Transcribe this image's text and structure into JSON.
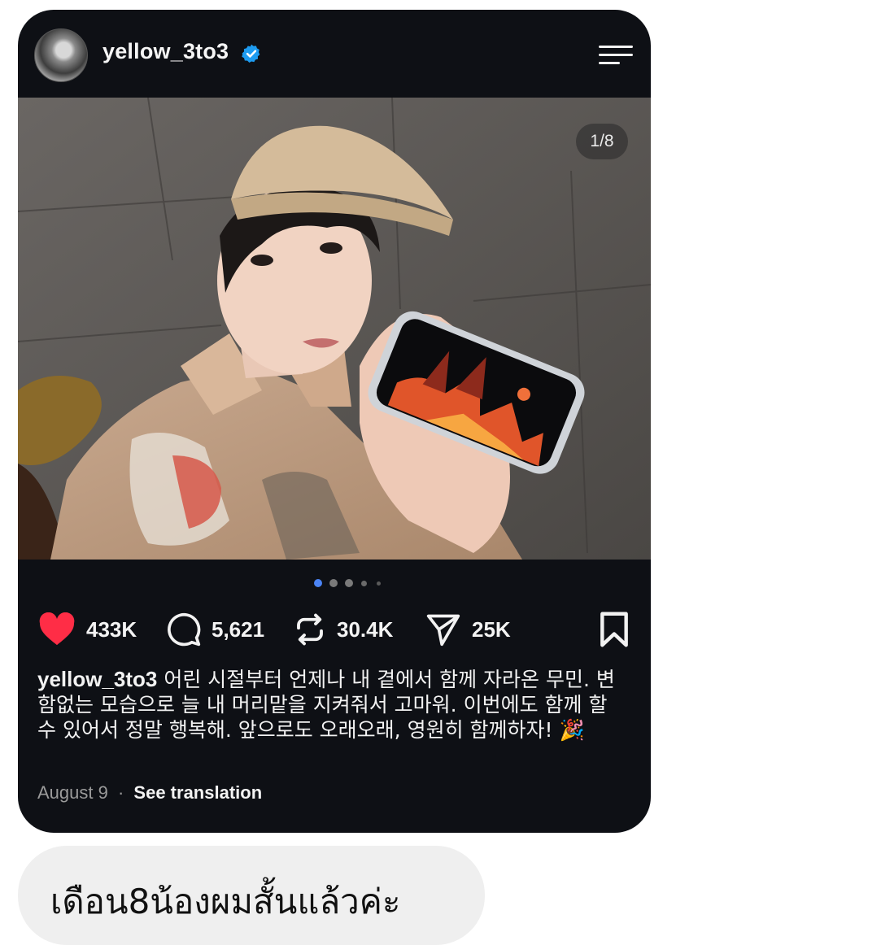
{
  "post": {
    "username": "yellow_3to3",
    "slide_counter": "1/8",
    "likes": "433K",
    "comments": "5,621",
    "reposts": "30.4K",
    "shares": "25K",
    "caption_user": "yellow_3to3",
    "caption_text": "어린 시절부터 언제나 내 곁에서 함께 자라온 무민. 변함없는 모습으로 늘 내 머리맡을 지켜줘서 고마워. 이번에도 함께 할 수 있어서 정말 행복해. 앞으로도 오래오래, 영원히 함께하자! 🎉",
    "date": "August 9",
    "separator": "·",
    "translate_label": "See translation",
    "carousel": {
      "slides_shown": 5,
      "active_index": 0
    },
    "like_color": "#ff2d46",
    "verified_color": "#1d9bf0"
  },
  "message": {
    "text": "เดือน8น้องผมสั้นแล้วค่ะ"
  },
  "icons": {
    "like": "heart-icon",
    "comment": "comment-bubble-icon",
    "repost": "repost-icon",
    "share": "send-icon",
    "save": "bookmark-icon",
    "menu": "hamburger-menu-icon",
    "verified": "verified-badge-icon"
  }
}
